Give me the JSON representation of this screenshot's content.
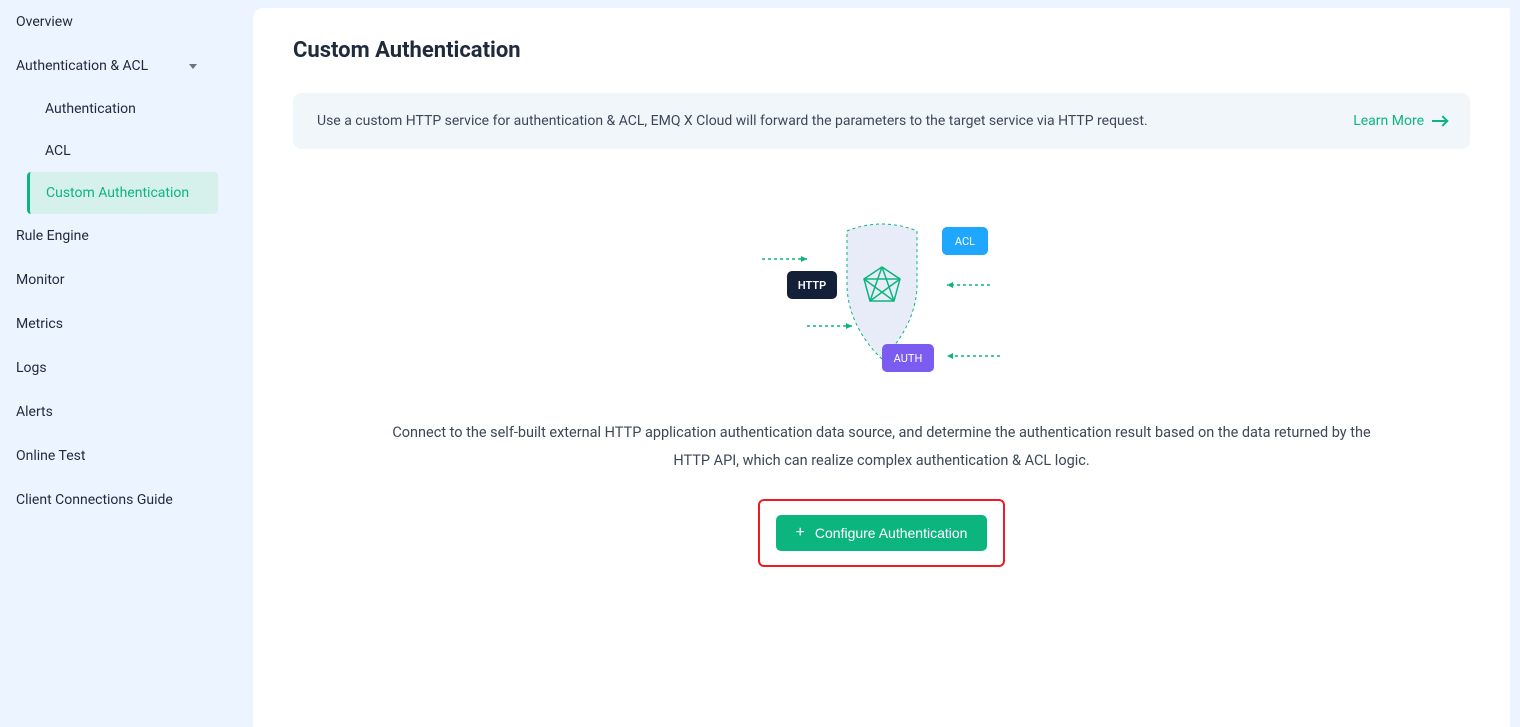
{
  "sidebar": {
    "items": [
      {
        "label": "Overview",
        "expandable": false
      },
      {
        "label": "Authentication & ACL",
        "expandable": true,
        "expanded": true,
        "children": [
          {
            "label": "Authentication",
            "active": false
          },
          {
            "label": "ACL",
            "active": false
          },
          {
            "label": "Custom Authentication",
            "active": true
          }
        ]
      },
      {
        "label": "Rule Engine",
        "expandable": false
      },
      {
        "label": "Monitor",
        "expandable": false
      },
      {
        "label": "Metrics",
        "expandable": false
      },
      {
        "label": "Logs",
        "expandable": false
      },
      {
        "label": "Alerts",
        "expandable": false
      },
      {
        "label": "Online Test",
        "expandable": false
      },
      {
        "label": "Client Connections Guide",
        "expandable": false
      }
    ]
  },
  "page": {
    "title": "Custom Authentication",
    "banner_text": "Use a custom HTTP service for authentication & ACL, EMQ X Cloud will forward the parameters to the target service via HTTP request.",
    "learn_more": "Learn More",
    "description": "Connect to the self-built external HTTP application authentication data source, and determine the authentication result based on the data returned by the HTTP API, which can realize complex authentication & ACL logic.",
    "configure_button": "Configure Authentication"
  },
  "illustration": {
    "http_label": "HTTP",
    "acl_label": "ACL",
    "auth_label": "AUTH"
  },
  "colors": {
    "accent_green": "#0db57e",
    "highlight_red": "#ed1c24",
    "acl_blue": "#1fa7ff",
    "auth_purple": "#7b5cf0",
    "http_dark": "#132038"
  }
}
